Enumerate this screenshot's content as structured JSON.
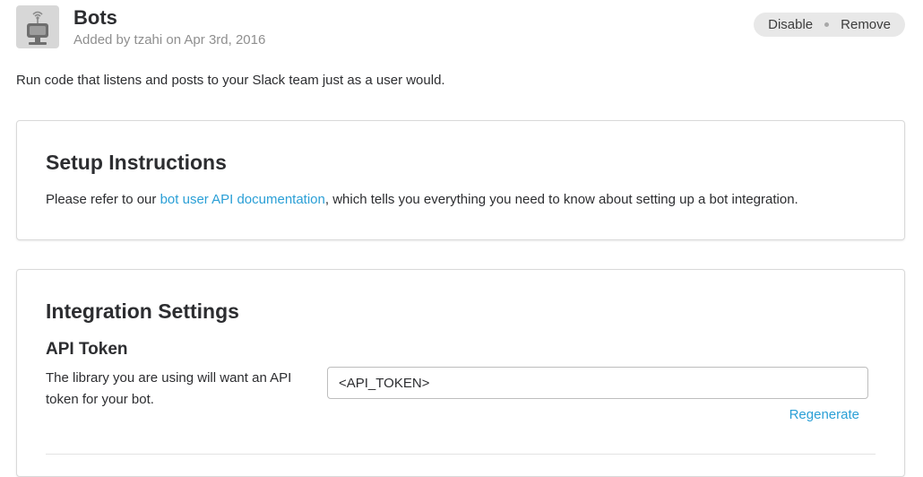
{
  "header": {
    "title": "Bots",
    "meta": "Added by tzahi on Apr 3rd, 2016",
    "actions": {
      "disable": "Disable",
      "remove": "Remove"
    }
  },
  "description": "Run code that listens and posts to your Slack team just as a user would.",
  "setup": {
    "heading": "Setup Instructions",
    "text_before": "Please refer to our ",
    "link": "bot user API documentation",
    "text_after": ", which tells you everything you need to know about setting up a bot integration."
  },
  "settings": {
    "heading": "Integration Settings",
    "api_token": {
      "label": "API Token",
      "help": "The library you are using will want an API token for your bot.",
      "value": "<API_TOKEN>",
      "regenerate": "Regenerate"
    }
  },
  "colors": {
    "link": "#2a9fd6",
    "muted": "#8f8f8f",
    "text": "#2c2d30"
  },
  "icons": {
    "bot": "robot-icon"
  }
}
